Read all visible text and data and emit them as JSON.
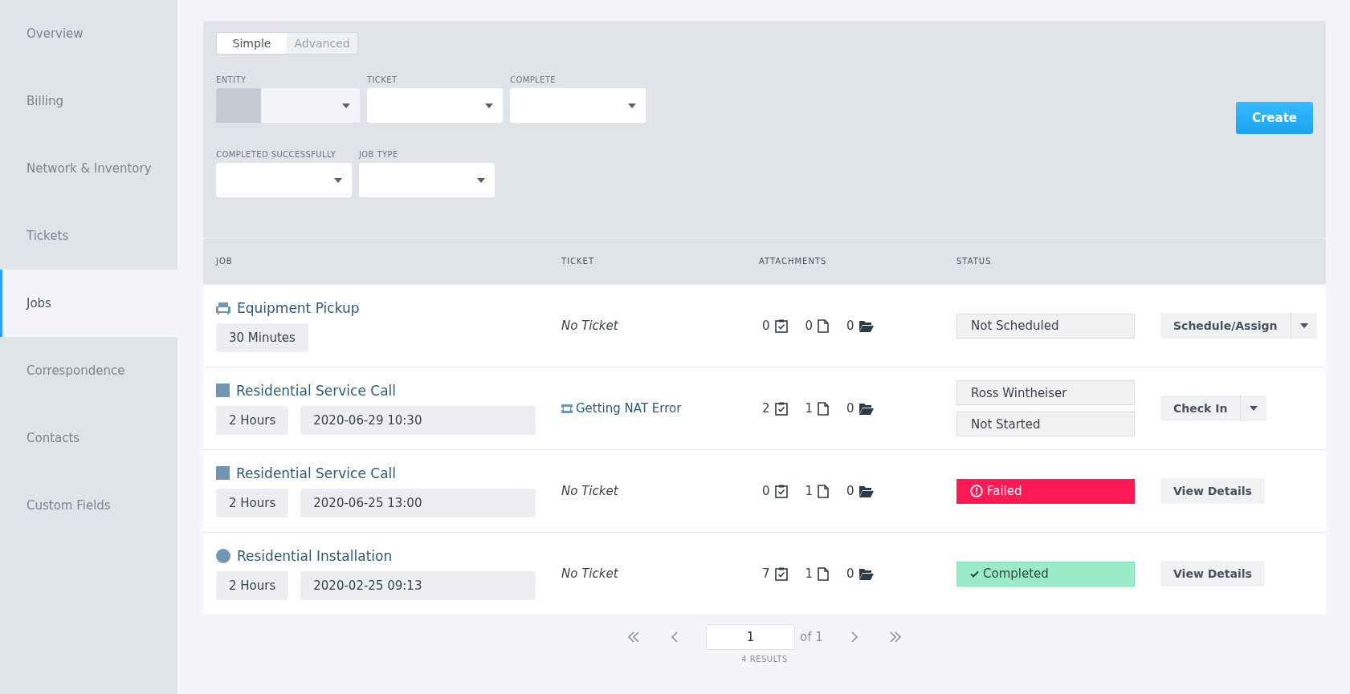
{
  "sidebar": {
    "items": [
      {
        "label": "Overview",
        "selected": false
      },
      {
        "label": "Billing",
        "selected": false
      },
      {
        "label": "Network & Inventory",
        "selected": false
      },
      {
        "label": "Tickets",
        "selected": false
      },
      {
        "label": "Jobs",
        "selected": true
      },
      {
        "label": "Correspondence",
        "selected": false
      },
      {
        "label": "Contacts",
        "selected": false
      },
      {
        "label": "Custom Fields",
        "selected": false
      }
    ]
  },
  "mode_tabs": [
    {
      "label": "Simple",
      "selected": true
    },
    {
      "label": "Advanced",
      "selected": false
    }
  ],
  "filters": [
    {
      "label": "ENTITY",
      "kind": "entity"
    },
    {
      "label": "TICKET",
      "kind": "select"
    },
    {
      "label": "COMPLETE",
      "kind": "select"
    },
    {
      "label": "COMPLETED SUCCESSFULLY",
      "kind": "select"
    },
    {
      "label": "JOB TYPE",
      "kind": "select"
    }
  ],
  "create_button": "Create",
  "table": {
    "columns": [
      "JOB",
      "TICKET",
      "ATTACHMENTS",
      "STATUS"
    ],
    "rows": [
      {
        "kind": "chair",
        "title": "Equipment Pickup",
        "duration": "30 Minutes",
        "date": null,
        "ticket": {
          "text": "No Ticket",
          "linked": false
        },
        "attachments": [
          "0",
          "0",
          "0"
        ],
        "statuses": [
          {
            "text": "Not Scheduled",
            "kind": "plain"
          }
        ],
        "action": {
          "label": "Schedule/Assign",
          "split": true
        }
      },
      {
        "kind": "square",
        "title": "Residential Service Call",
        "duration": "2 Hours",
        "date": "2020-06-29 10:30",
        "ticket": {
          "text": "Getting NAT Error",
          "linked": true
        },
        "attachments": [
          "2",
          "1",
          "0"
        ],
        "statuses": [
          {
            "text": "Ross Wintheiser",
            "kind": "plain"
          },
          {
            "text": "Not Started",
            "kind": "plain"
          }
        ],
        "action": {
          "label": "Check In",
          "split": true
        }
      },
      {
        "kind": "square",
        "title": "Residential Service Call",
        "duration": "2 Hours",
        "date": "2020-06-25 13:00",
        "ticket": {
          "text": "No Ticket",
          "linked": false
        },
        "attachments": [
          "0",
          "1",
          "0"
        ],
        "statuses": [
          {
            "text": "Failed",
            "kind": "failed"
          }
        ],
        "action": {
          "label": "View Details",
          "split": false
        }
      },
      {
        "kind": "circle",
        "title": "Residential Installation",
        "duration": "2 Hours",
        "date": "2020-02-25 09:13",
        "ticket": {
          "text": "No Ticket",
          "linked": false
        },
        "attachments": [
          "7",
          "1",
          "0"
        ],
        "statuses": [
          {
            "text": "Completed",
            "kind": "completed"
          }
        ],
        "action": {
          "label": "View Details",
          "split": false
        }
      }
    ]
  },
  "pagination": {
    "page": "1",
    "of": "of 1",
    "results": "4 RESULTS"
  }
}
